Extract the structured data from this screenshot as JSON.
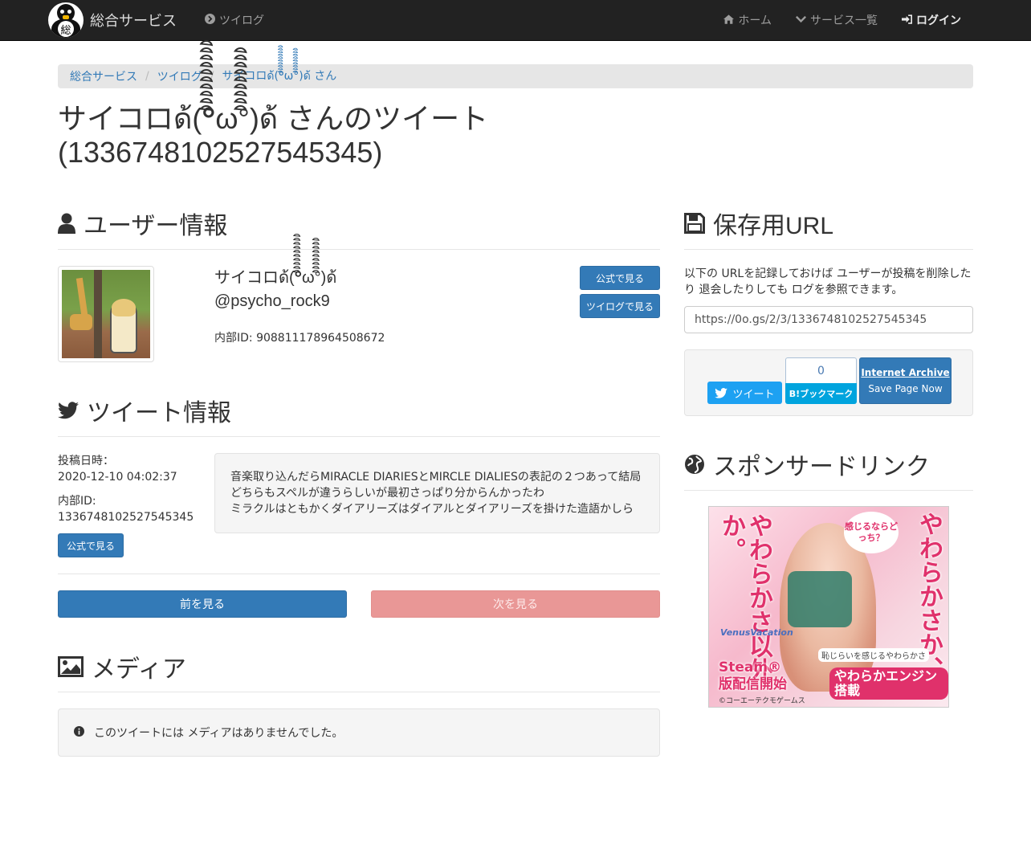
{
  "nav": {
    "brand": "総合サービス",
    "logo_char": "総",
    "left_link": "ツイログ",
    "home": "ホーム",
    "services": "サービス一覧",
    "login": "ログイン"
  },
  "breadcrumb": [
    "総合サービス",
    "ツイログ",
    "サイコロด้(°ิิิิิิิิิิω°ิิิิิิิิิ)ด้ さん"
  ],
  "title": "サイコロด้(°ิิิิิิิิิิω°ิิิิิิิิิ)ด้ さんのツイート (1336748102527545345)",
  "user_section": {
    "heading": "ユーザー情報",
    "display_name": "サイコロด้(°ิิิิิิิิิิω°ิิิิิิิิิ)ด้",
    "screen_name": "@psycho_rock9",
    "internal_id": "内部ID: 908811178964508672",
    "btn_official": "公式で見る",
    "btn_twilog": "ツイログで見る"
  },
  "tweet_section": {
    "heading": "ツイート情報",
    "posted_label": "投稿日時：",
    "posted_value": "2020-12-10 04:02:37",
    "id_label": "内部ID:",
    "id_value": "1336748102527545345",
    "btn_official": "公式で見る",
    "text_lines": [
      "音楽取り込んだらMIRACLE DIARIESとMIRCLE DIALIESの表記の２つあって結局",
      "どちらもスペルが違うらしいが最初さっぱり分からんかったわ",
      "ミラクルはともかくダイアリーズはダイアルとダイアリーズを掛けた造語かしら"
    ],
    "prev": "前を見る",
    "next": "次を見る"
  },
  "media_section": {
    "heading": "メディア",
    "empty_msg": "このツイートには メディアはありませんでした。"
  },
  "save_section": {
    "heading": "保存用URL",
    "desc": "以下の URLを記録しておけば ユーザーが投稿を削除したり 退会したりしても ログを参照できます。",
    "url": "https://0o.gs/2/3/1336748102527545345",
    "tweet_btn": "ツイート",
    "hatena_count": "0",
    "hatena_btn": "B!ブックマーク",
    "ia_title": "Internet Archive",
    "ia_sub": "Save Page Now"
  },
  "sponsor_section": {
    "heading": "スポンサードリンク",
    "ad": {
      "left_text": "やわらかさ以外か。",
      "right_text": "やわらかさか、",
      "bubble": "感じるならどっち？",
      "logo": "VenusVacation",
      "steam": "Steam®版配信開始",
      "copy": "©コーエーテクモゲームス",
      "sub": "恥じらいを感じるやわらかさ",
      "engine": "やわらかエンジン搭載"
    }
  }
}
